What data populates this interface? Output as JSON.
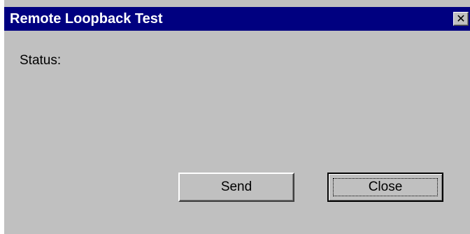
{
  "window": {
    "title": "Remote Loopback Test",
    "close_glyph": "✕"
  },
  "content": {
    "status_label": "Status:"
  },
  "buttons": {
    "send_label": "Send",
    "close_label": "Close"
  },
  "colors": {
    "title_bar": "#000080",
    "dialog_background": "#c0c0c0",
    "title_text": "#ffffff"
  }
}
